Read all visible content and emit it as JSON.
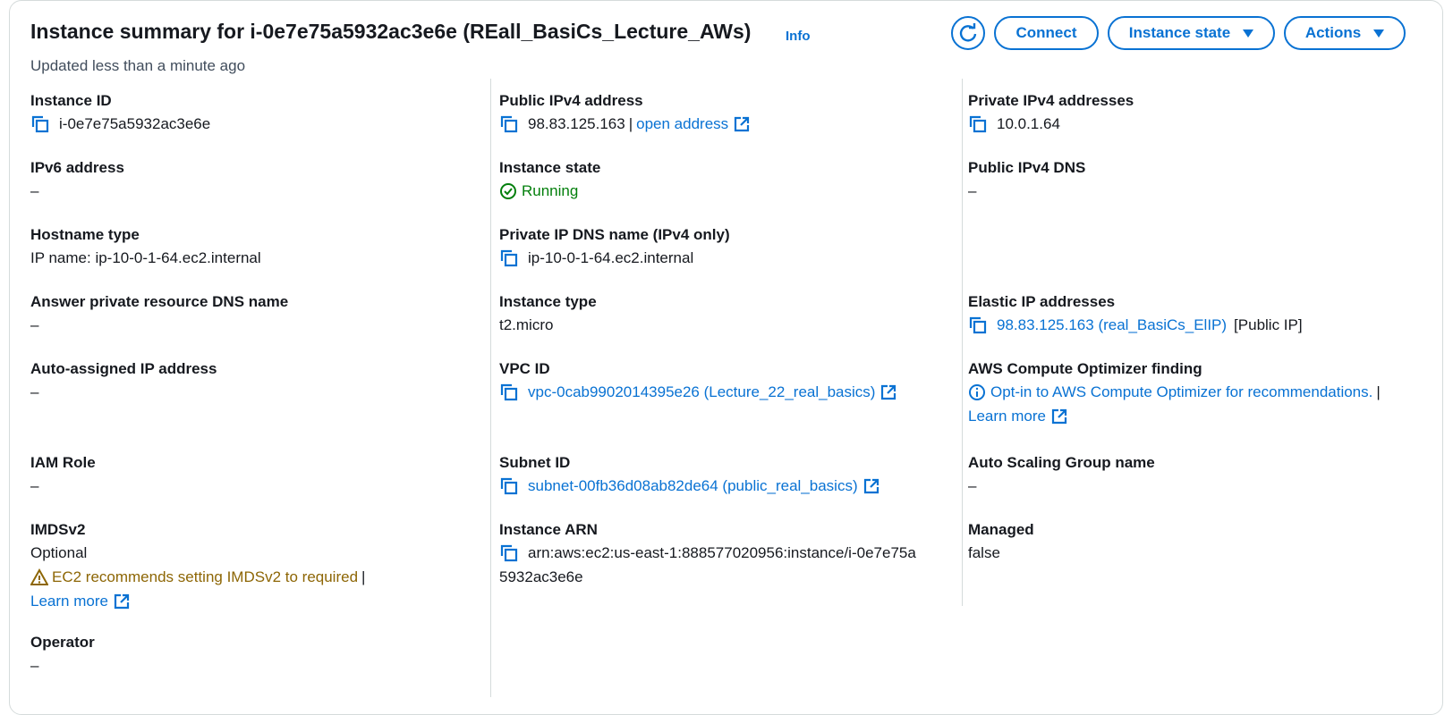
{
  "header": {
    "title": "Instance summary for i-0e7e75a5932ac3e6e (REall_BasiCs_Lecture_AWs)",
    "info_label": "Info",
    "updated": "Updated less than a minute ago",
    "refresh_icon": "refresh-icon",
    "connect_label": "Connect",
    "instance_state_label": "Instance state",
    "actions_label": "Actions"
  },
  "colors": {
    "link": "#0972d3",
    "success": "#037f0c",
    "warning": "#8d6605",
    "divider": "#d5dbdb"
  },
  "col1": {
    "instance_id": {
      "label": "Instance ID",
      "value": "i-0e7e75a5932ac3e6e"
    },
    "ipv6": {
      "label": "IPv6 address",
      "value": "–"
    },
    "hostname_type": {
      "label": "Hostname type",
      "value": "IP name: ip-10-0-1-64.ec2.internal"
    },
    "answer_dns": {
      "label": "Answer private resource DNS name",
      "value": "–"
    },
    "auto_ip": {
      "label": "Auto-assigned IP address",
      "value": "–"
    },
    "iam_role": {
      "label": "IAM Role",
      "value": "–"
    },
    "imdsv2": {
      "label": "IMDSv2",
      "value": "Optional",
      "warning": "EC2 recommends setting IMDSv2 to required",
      "sep": "|",
      "learn_more": "Learn more"
    },
    "operator": {
      "label": "Operator",
      "value": "–"
    }
  },
  "col2": {
    "public_ipv4": {
      "label": "Public IPv4 address",
      "value": "98.83.125.163",
      "sep": "|",
      "link": "open address"
    },
    "instance_state": {
      "label": "Instance state",
      "value": "Running"
    },
    "private_dns": {
      "label": "Private IP DNS name (IPv4 only)",
      "value": "ip-10-0-1-64.ec2.internal"
    },
    "instance_type": {
      "label": "Instance type",
      "value": "t2.micro"
    },
    "vpc_id": {
      "label": "VPC ID",
      "value": "vpc-0cab9902014395e26 (Lecture_22_real_basics)"
    },
    "subnet_id": {
      "label": "Subnet ID",
      "value": "subnet-00fb36d08ab82de64 (public_real_basics)"
    },
    "arn": {
      "label": "Instance ARN",
      "line1": "arn:aws:ec2:us-east-1:888577020956:instance/i-0e7e75a",
      "line2": "5932ac3e6e"
    }
  },
  "col3": {
    "private_ipv4": {
      "label": "Private IPv4 addresses",
      "value": "10.0.1.64"
    },
    "public_dns": {
      "label": "Public IPv4 DNS",
      "value": "–"
    },
    "elastic_ip": {
      "label": "Elastic IP addresses",
      "value": "98.83.125.163 (real_BasiCs_ElIP)",
      "suffix": "[Public IP]"
    },
    "optimizer": {
      "label": "AWS Compute Optimizer finding",
      "value": "Opt-in to AWS Compute Optimizer for recommendations.",
      "sep": "|",
      "learn_more": "Learn more"
    },
    "asg": {
      "label": "Auto Scaling Group name",
      "value": "–"
    },
    "managed": {
      "label": "Managed",
      "value": "false"
    }
  }
}
